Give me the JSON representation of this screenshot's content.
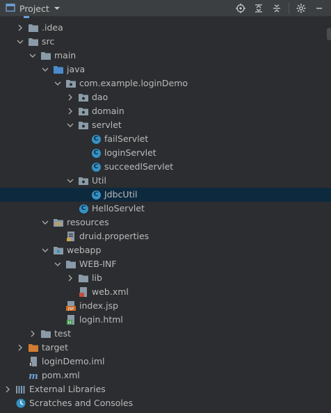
{
  "header": {
    "title": "Project",
    "tools": [
      "locate-icon",
      "expand-all-icon",
      "collapse-all-icon",
      "gear-icon"
    ]
  },
  "tree": [
    {
      "label": ".idea",
      "depth": 1,
      "expand": "collapsed",
      "icon": "folder"
    },
    {
      "label": "src",
      "depth": 1,
      "expand": "expanded",
      "icon": "folder"
    },
    {
      "label": "main",
      "depth": 2,
      "expand": "expanded",
      "icon": "folder"
    },
    {
      "label": "java",
      "depth": 3,
      "expand": "expanded",
      "icon": "source-folder"
    },
    {
      "label": "com.example.loginDemo",
      "depth": 4,
      "expand": "expanded",
      "icon": "package"
    },
    {
      "label": "dao",
      "depth": 5,
      "expand": "collapsed",
      "icon": "package"
    },
    {
      "label": "domain",
      "depth": 5,
      "expand": "collapsed",
      "icon": "package"
    },
    {
      "label": "servlet",
      "depth": 5,
      "expand": "expanded",
      "icon": "package"
    },
    {
      "label": "failServlet",
      "depth": 6,
      "expand": "none",
      "icon": "class"
    },
    {
      "label": "loginServlet",
      "depth": 6,
      "expand": "none",
      "icon": "class"
    },
    {
      "label": "succeedlServlet",
      "depth": 6,
      "expand": "none",
      "icon": "class"
    },
    {
      "label": "Util",
      "depth": 5,
      "expand": "expanded",
      "icon": "package"
    },
    {
      "label": "JdbcUtil",
      "depth": 6,
      "expand": "none",
      "icon": "class",
      "selected": true
    },
    {
      "label": "HelloServlet",
      "depth": 5,
      "expand": "none",
      "icon": "class"
    },
    {
      "label": "resources",
      "depth": 3,
      "expand": "expanded",
      "icon": "resources-folder"
    },
    {
      "label": "druid.properties",
      "depth": 4,
      "expand": "none",
      "icon": "properties"
    },
    {
      "label": "webapp",
      "depth": 3,
      "expand": "expanded",
      "icon": "web-folder"
    },
    {
      "label": "WEB-INF",
      "depth": 4,
      "expand": "expanded",
      "icon": "folder"
    },
    {
      "label": "lib",
      "depth": 5,
      "expand": "collapsed",
      "icon": "folder"
    },
    {
      "label": "web.xml",
      "depth": 5,
      "expand": "none",
      "icon": "xml"
    },
    {
      "label": "index.jsp",
      "depth": 4,
      "expand": "none",
      "icon": "jsp"
    },
    {
      "label": "login.html",
      "depth": 4,
      "expand": "none",
      "icon": "html"
    },
    {
      "label": "test",
      "depth": 2,
      "expand": "collapsed",
      "icon": "folder"
    },
    {
      "label": "target",
      "depth": 1,
      "expand": "collapsed",
      "icon": "target-folder"
    },
    {
      "label": "loginDemo.iml",
      "depth": 1,
      "expand": "none",
      "icon": "iml"
    },
    {
      "label": "pom.xml",
      "depth": 1,
      "expand": "none",
      "icon": "maven"
    },
    {
      "label": "External Libraries",
      "depth": 0,
      "expand": "collapsed",
      "icon": "libraries"
    },
    {
      "label": "Scratches and Consoles",
      "depth": 0,
      "expand": "none",
      "icon": "scratches"
    }
  ],
  "colors": {
    "selected_row": "#0d293e",
    "folder": "#8a9aa8",
    "package_folder": "#8b9ba8",
    "source_folder": "#4b8bcb",
    "class_badge": "#3592c4",
    "target_folder": "#d27c32"
  }
}
